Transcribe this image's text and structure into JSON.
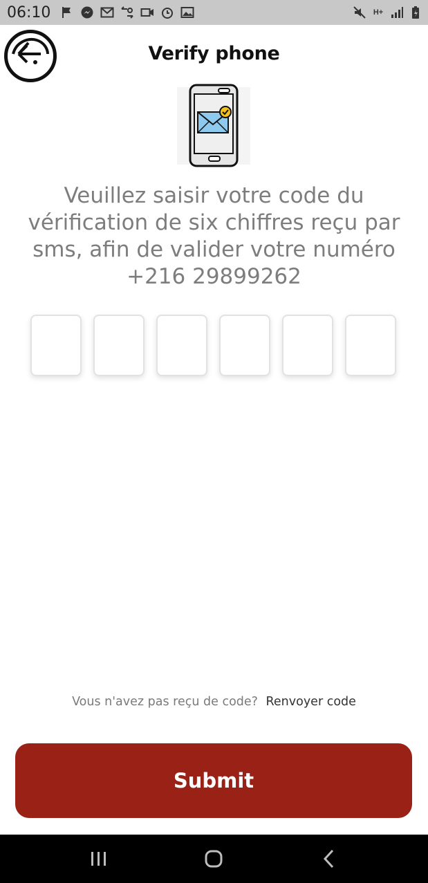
{
  "status_bar": {
    "time": "06:10",
    "left_icons": [
      "flag-icon",
      "messenger-icon",
      "gmail-icon",
      "sync-icon",
      "video-icon",
      "alarm-icon",
      "image-icon"
    ],
    "right_icons": [
      "mute-icon",
      "network-hplus-icon",
      "signal-icon",
      "battery-charging-icon"
    ],
    "network_label": "H+"
  },
  "header": {
    "title": "Verify phone",
    "back_icon": "back-arrow-face-icon"
  },
  "illustration": {
    "icon": "phone-message-check-icon"
  },
  "instruction": {
    "line1": "Veuillez saisir votre code du",
    "line2": "vérification de six chiffres reçu par",
    "line3": "sms, afin de valider votre numéro",
    "line4": "+216 29899262"
  },
  "code_inputs": [
    "",
    "",
    "",
    "",
    "",
    ""
  ],
  "resend": {
    "question": "Vous n'avez pas reçu de code?",
    "link": "Renvoyer code"
  },
  "submit": {
    "label": "Submit"
  },
  "colors": {
    "accent": "#9a2116",
    "text_muted": "#7d7d7d",
    "status_bar": "#c8c8c8"
  },
  "nav_bar": {
    "icons": [
      "recents-icon",
      "home-icon",
      "back-icon"
    ]
  }
}
